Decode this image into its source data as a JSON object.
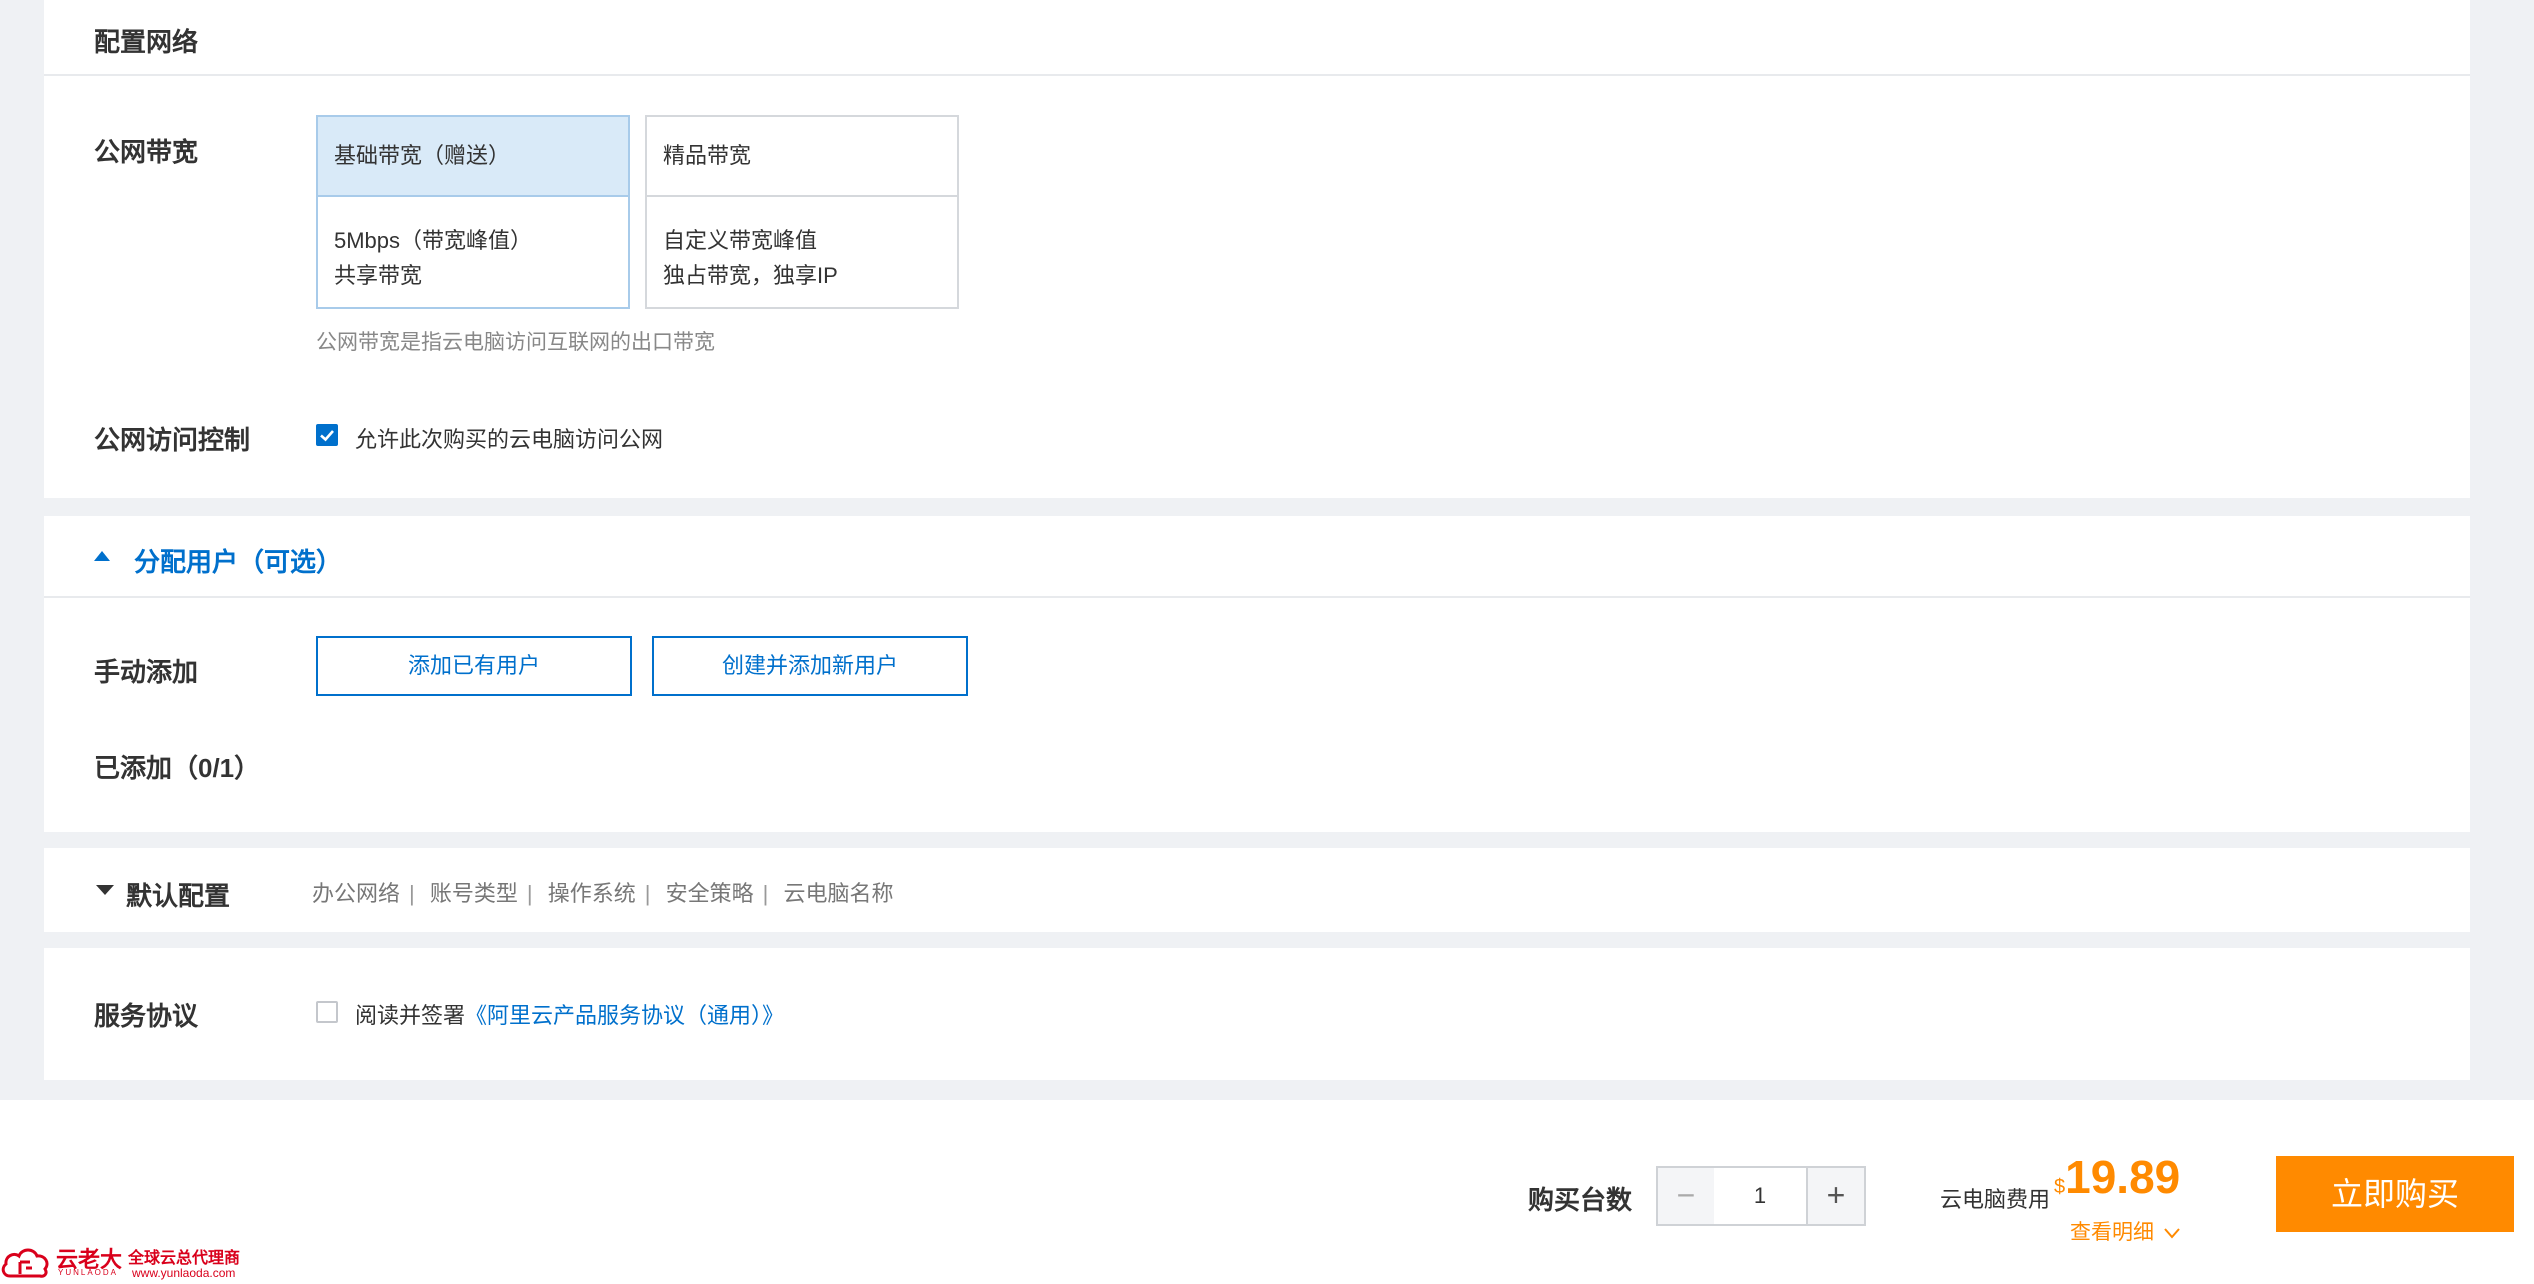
{
  "network": {
    "section_title": "配置网络",
    "bandwidth_label": "公网带宽",
    "cards": [
      {
        "title": "基础带宽（赠送）",
        "line1": "5Mbps（带宽峰值）",
        "line2": "共享带宽"
      },
      {
        "title": "精品带宽",
        "line1": "自定义带宽峰值",
        "line2": "独占带宽，独享IP"
      }
    ],
    "selected_card": "基础带宽（赠送）",
    "bandwidth_hint": "公网带宽是指云电脑访问互联网的出口带宽",
    "access_label": "公网访问控制",
    "access_checkbox_label": "允许此次购买的云电脑访问公网",
    "access_checked": true
  },
  "users": {
    "section_title": "分配用户（可选）",
    "manual_label": "手动添加",
    "add_existing_label": "添加已有用户",
    "create_new_label": "创建并添加新用户",
    "added_count": "已添加（0/1）"
  },
  "defaults": {
    "section_title": "默认配置",
    "items": [
      "办公网络",
      "账号类型",
      "操作系统",
      "安全策略",
      "云电脑名称"
    ]
  },
  "agreement": {
    "label": "服务协议",
    "read_text": "阅读并签署",
    "link_text": "《阿里云产品服务协议（通用）》",
    "checked": false
  },
  "purchase": {
    "qty_label": "购买台数",
    "quantity": "1",
    "minus": "−",
    "plus": "+",
    "fee_label": "云电脑费用",
    "currency": "$",
    "price": "19.89",
    "detail_link": "查看明细",
    "buy_label": "立即购买"
  },
  "watermark": {
    "brand": "云老大",
    "tagline": "全球云总代理商",
    "pinyin": "YUNLAODA",
    "url": "www.yunlaoda.com"
  },
  "colors": {
    "accent": "#0070cc",
    "price": "#ff8a00",
    "buy_button": "#ff8a00",
    "selected_card_bg": "#d9eaf8",
    "watermark": "#d9001b"
  },
  "icons": {
    "collapse": "caret-up-icon",
    "expand": "caret-down-icon",
    "detail": "chevron-down-icon",
    "check": "check-icon"
  }
}
